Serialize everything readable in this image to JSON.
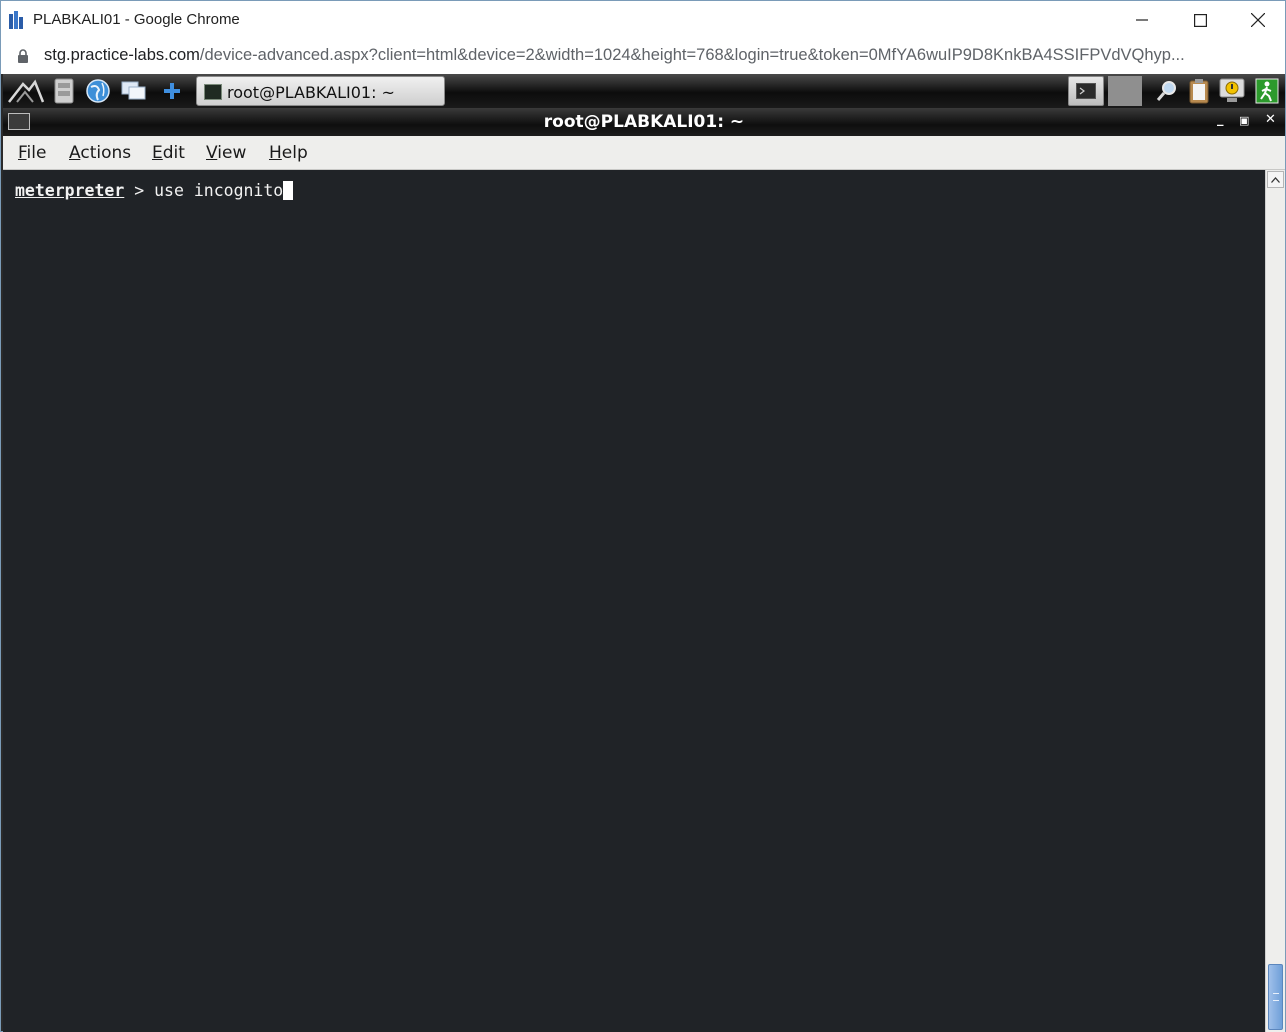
{
  "browser": {
    "window_title": "PLABKALI01 - Google Chrome",
    "url_host": "stg.practice-labs.com",
    "url_path": "/device-advanced.aspx?client=html&device=2&width=1024&height=768&login=true&token=0MfYA6wuIP9D8KnkBA4SSIFPVdVQhyp...",
    "controls": {
      "minimize_icon": "minimize-icon",
      "maximize_icon": "maximize-icon",
      "close_icon": "close-icon"
    }
  },
  "panel": {
    "launchers": [
      "kali-menu-icon",
      "file-manager-icon",
      "web-browser-icon",
      "show-desktop-icon",
      "add-icon"
    ],
    "task_label": "root@PLABKALI01: ~",
    "tray": [
      "terminal-icon",
      "search-icon",
      "clipboard-icon",
      "power-icon",
      "logout-icon"
    ]
  },
  "terminal": {
    "window_title": "root@PLABKALI01: ~",
    "menu": {
      "file": {
        "mnemonic": "F",
        "rest": "ile"
      },
      "actions": {
        "mnemonic": "A",
        "rest": "ctions"
      },
      "edit": {
        "mnemonic": "E",
        "rest": "dit"
      },
      "view": {
        "mnemonic": "V",
        "rest": "iew"
      },
      "help": {
        "mnemonic": "H",
        "rest": "elp"
      }
    },
    "prompt_name": "meterpreter",
    "prompt_separator": " > ",
    "command": "use incognito"
  }
}
